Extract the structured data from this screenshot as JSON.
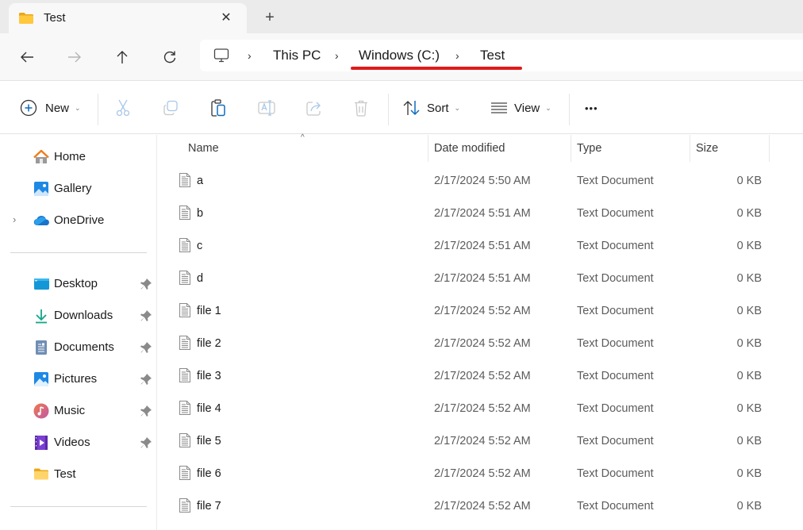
{
  "tabs": [
    {
      "title": "Test",
      "icon": "folder-icon",
      "active": true
    }
  ],
  "tab_controls": {
    "close_glyph": "✕",
    "new_tab_glyph": "+"
  },
  "nav": {
    "back": "back-arrow-icon",
    "forward": "forward-arrow-icon",
    "up": "up-arrow-icon",
    "refresh": "refresh-icon"
  },
  "breadcrumb": {
    "root_icon": "this-pc-icon",
    "separator": "›",
    "items": [
      "This PC",
      "Windows (C:)",
      "Test"
    ],
    "annotation_color": "#e01b1b"
  },
  "commands": {
    "new_label": "New",
    "sort_label": "Sort",
    "view_label": "View",
    "more_glyph": "•••",
    "caret": "⌄",
    "icon_actions": [
      "cut",
      "copy",
      "paste",
      "rename",
      "share",
      "delete"
    ]
  },
  "sidebar": {
    "top_items": [
      {
        "label": "Home",
        "icon": "home-icon"
      },
      {
        "label": "Gallery",
        "icon": "gallery-icon"
      },
      {
        "label": "OneDrive",
        "icon": "onedrive-icon",
        "expandable": true
      }
    ],
    "quick_access": [
      {
        "label": "Desktop",
        "icon": "desktop-icon",
        "pinned": true
      },
      {
        "label": "Downloads",
        "icon": "downloads-icon",
        "pinned": true
      },
      {
        "label": "Documents",
        "icon": "documents-icon",
        "pinned": true
      },
      {
        "label": "Pictures",
        "icon": "pictures-icon",
        "pinned": true
      },
      {
        "label": "Music",
        "icon": "music-icon",
        "pinned": true
      },
      {
        "label": "Videos",
        "icon": "videos-icon",
        "pinned": true
      },
      {
        "label": "Test",
        "icon": "folder-icon",
        "pinned": false
      }
    ],
    "expander_glyph": "›"
  },
  "filelist": {
    "columns": [
      "Name",
      "Date modified",
      "Type",
      "Size"
    ],
    "sort_indicator": "^",
    "rows": [
      {
        "name": "a",
        "date": "2/17/2024 5:50 AM",
        "type": "Text Document",
        "size": "0 KB"
      },
      {
        "name": "b",
        "date": "2/17/2024 5:51 AM",
        "type": "Text Document",
        "size": "0 KB"
      },
      {
        "name": "c",
        "date": "2/17/2024 5:51 AM",
        "type": "Text Document",
        "size": "0 KB"
      },
      {
        "name": "d",
        "date": "2/17/2024 5:51 AM",
        "type": "Text Document",
        "size": "0 KB"
      },
      {
        "name": "file 1",
        "date": "2/17/2024 5:52 AM",
        "type": "Text Document",
        "size": "0 KB"
      },
      {
        "name": "file 2",
        "date": "2/17/2024 5:52 AM",
        "type": "Text Document",
        "size": "0 KB"
      },
      {
        "name": "file 3",
        "date": "2/17/2024 5:52 AM",
        "type": "Text Document",
        "size": "0 KB"
      },
      {
        "name": "file 4",
        "date": "2/17/2024 5:52 AM",
        "type": "Text Document",
        "size": "0 KB"
      },
      {
        "name": "file 5",
        "date": "2/17/2024 5:52 AM",
        "type": "Text Document",
        "size": "0 KB"
      },
      {
        "name": "file 6",
        "date": "2/17/2024 5:52 AM",
        "type": "Text Document",
        "size": "0 KB"
      },
      {
        "name": "file 7",
        "date": "2/17/2024 5:52 AM",
        "type": "Text Document",
        "size": "0 KB"
      }
    ]
  }
}
